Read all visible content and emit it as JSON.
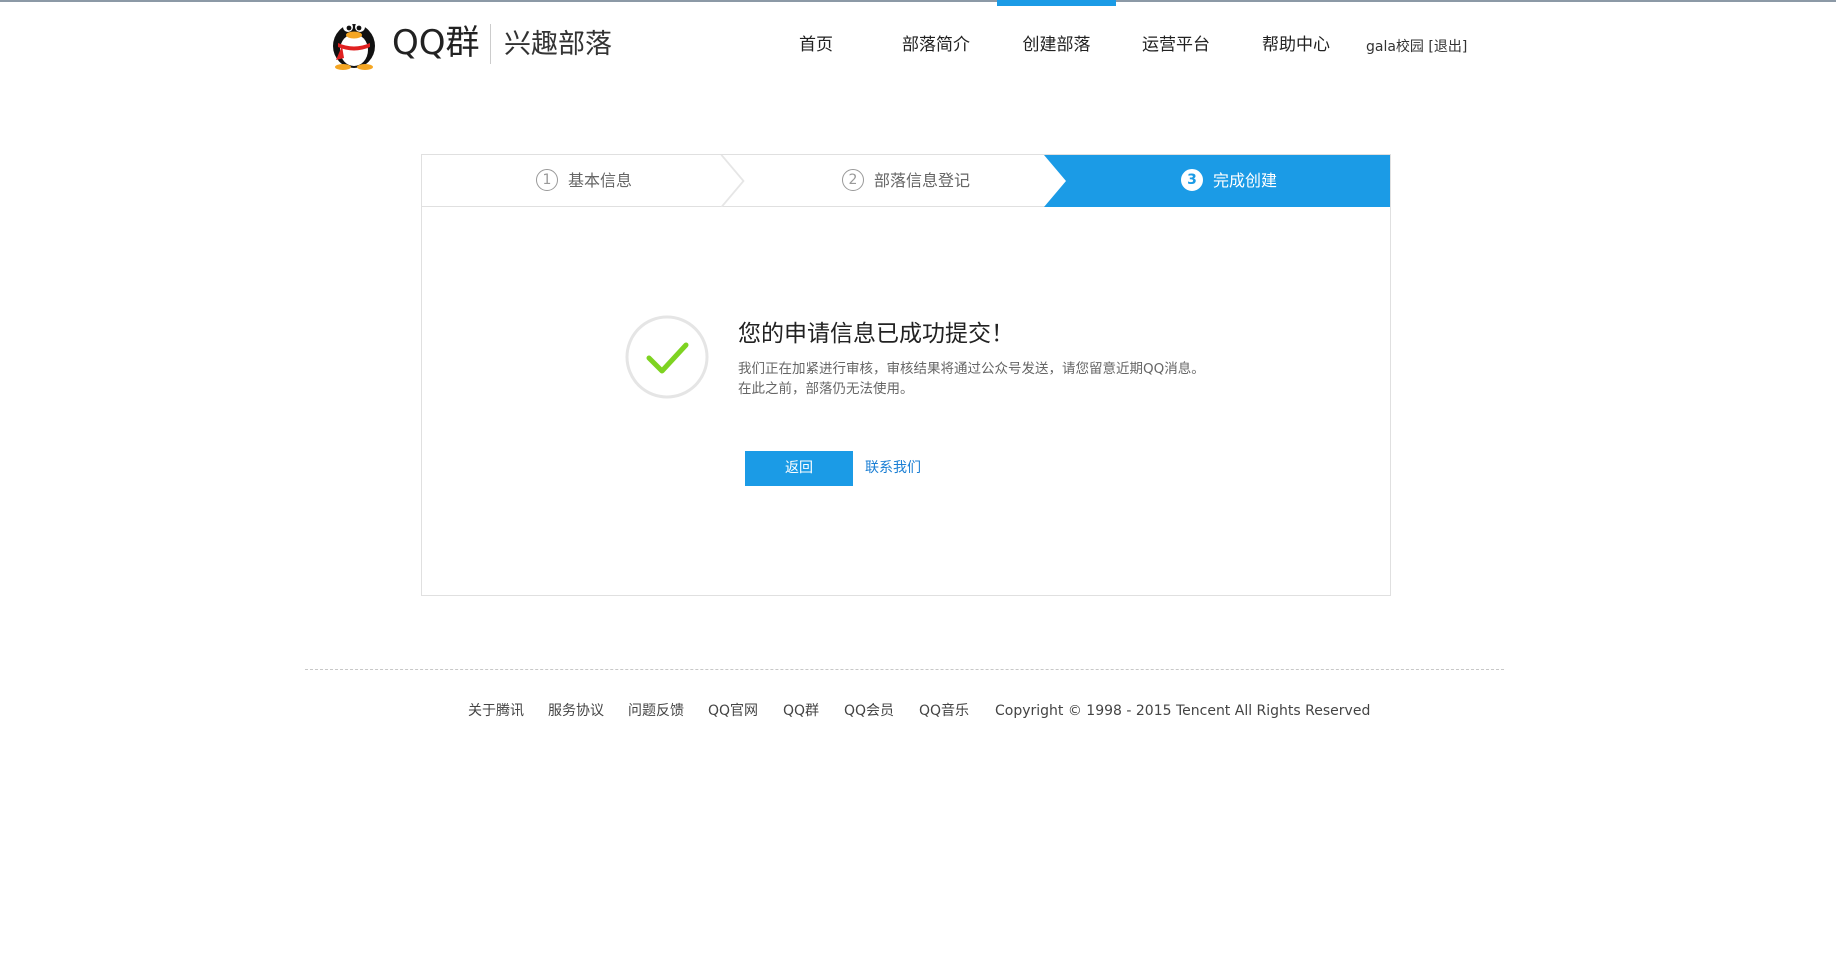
{
  "brand": {
    "logo_text": "QQ群",
    "sub_title": "兴趣部落"
  },
  "nav": {
    "items": [
      {
        "label": "首页",
        "active": false
      },
      {
        "label": "部落简介",
        "active": false
      },
      {
        "label": "创建部落",
        "active": true
      },
      {
        "label": "运营平台",
        "active": false
      },
      {
        "label": "帮助中心",
        "active": false
      }
    ],
    "user_name": "gala校园",
    "logout_label": "[退出]"
  },
  "steps": [
    {
      "num": "1",
      "label": "基本信息",
      "current": false
    },
    {
      "num": "2",
      "label": "部落信息登记",
      "current": false
    },
    {
      "num": "3",
      "label": "完成创建",
      "current": true
    }
  ],
  "result": {
    "title": "您的申请信息已成功提交！",
    "desc_line1": "我们正在加紧进行审核，审核结果将通过公众号发送，请您留意近期QQ消息。",
    "desc_line2": "在此之前，部落仍无法使用。",
    "back_label": "返回",
    "contact_label": "联系我们"
  },
  "footer": {
    "links": [
      "关于腾讯",
      "服务协议",
      "问题反馈",
      "QQ官网",
      "QQ群",
      "QQ会员",
      "QQ音乐"
    ],
    "copyright": "Copyright © 1998 - 2015 Tencent All Rights Reserved"
  },
  "colors": {
    "accent": "#1b9be6",
    "link": "#1b7fd4",
    "success_check": "#7ed321"
  }
}
